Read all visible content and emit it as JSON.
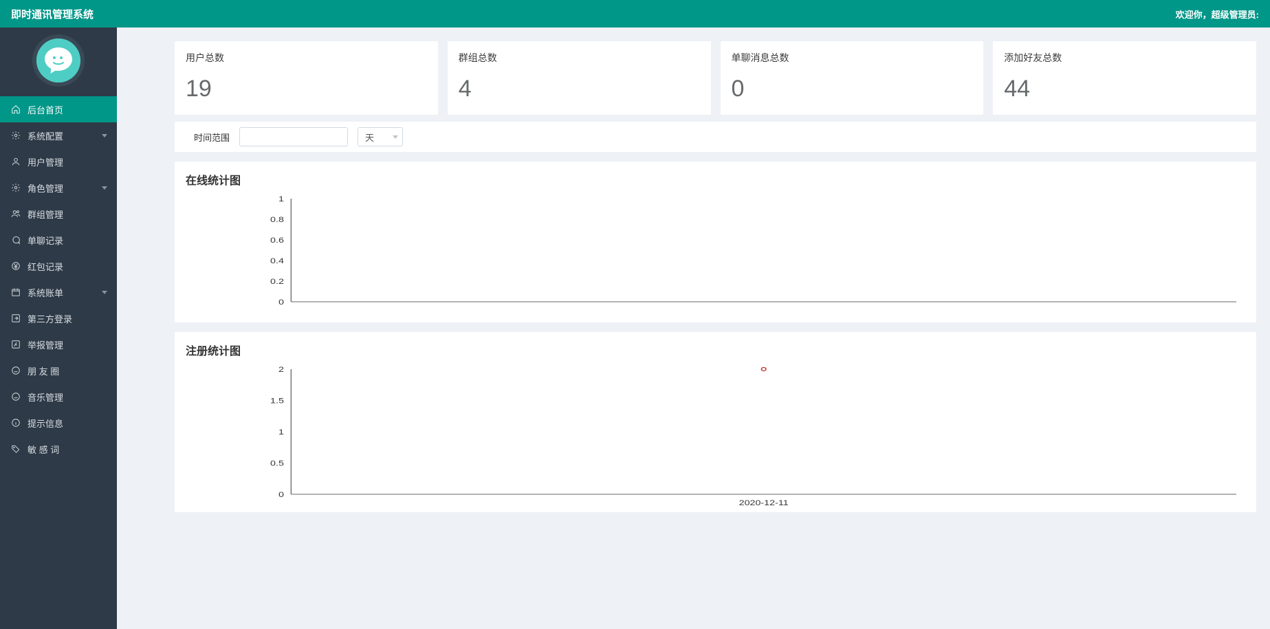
{
  "header": {
    "title": "即时通讯管理系统",
    "welcome": "欢迎你，超级管理员:"
  },
  "sidebar": {
    "items": [
      {
        "label": "后台首页",
        "icon": "home",
        "active": true,
        "expandable": false
      },
      {
        "label": "系统配置",
        "icon": "gear",
        "active": false,
        "expandable": true
      },
      {
        "label": "用户管理",
        "icon": "user",
        "active": false,
        "expandable": false
      },
      {
        "label": "角色管理",
        "icon": "gear",
        "active": false,
        "expandable": true
      },
      {
        "label": "群组管理",
        "icon": "users",
        "active": false,
        "expandable": false
      },
      {
        "label": "单聊记录",
        "icon": "chat",
        "active": false,
        "expandable": false
      },
      {
        "label": "红包记录",
        "icon": "yen",
        "active": false,
        "expandable": false
      },
      {
        "label": "系统账单",
        "icon": "cal",
        "active": false,
        "expandable": true
      },
      {
        "label": "第三方登录",
        "icon": "arrow",
        "active": false,
        "expandable": false
      },
      {
        "label": "举报管理",
        "icon": "flag",
        "active": false,
        "expandable": false
      },
      {
        "label": "朋 友 圈",
        "icon": "smile",
        "active": false,
        "expandable": false
      },
      {
        "label": "音乐管理",
        "icon": "smile",
        "active": false,
        "expandable": false
      },
      {
        "label": "提示信息",
        "icon": "info",
        "active": false,
        "expandable": false
      },
      {
        "label": "敏 感 词",
        "icon": "tag",
        "active": false,
        "expandable": false
      }
    ]
  },
  "stats": [
    {
      "label": "用户总数",
      "value": "19"
    },
    {
      "label": "群组总数",
      "value": "4"
    },
    {
      "label": "单聊消息总数",
      "value": "0"
    },
    {
      "label": "添加好友总数",
      "value": "44"
    }
  ],
  "filter": {
    "range_label": "时间范围",
    "range_value": "",
    "unit_selected": "天"
  },
  "charts": {
    "online": {
      "title": "在线统计图"
    },
    "register": {
      "title": "注册统计图"
    }
  },
  "chart_data": [
    {
      "type": "line",
      "title": "在线统计图",
      "xlabel": "",
      "ylabel": "",
      "ylim": [
        0,
        1
      ],
      "yticks": [
        0,
        0.2,
        0.4,
        0.6,
        0.8,
        1
      ],
      "categories": [],
      "values": []
    },
    {
      "type": "line",
      "title": "注册统计图",
      "xlabel": "",
      "ylabel": "",
      "ylim": [
        0,
        2
      ],
      "yticks": [
        0,
        0.5,
        1,
        1.5,
        2
      ],
      "categories": [
        "2020-12-11"
      ],
      "values": [
        2
      ]
    }
  ]
}
